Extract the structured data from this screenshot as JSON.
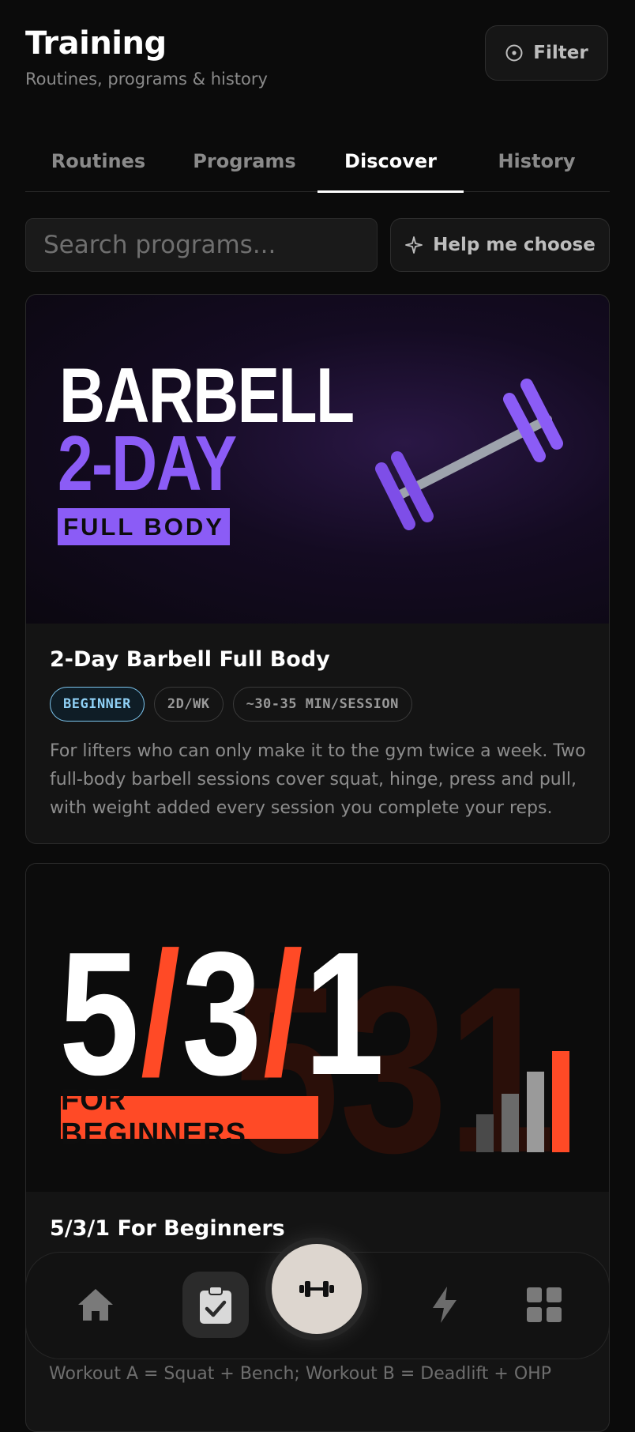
{
  "header": {
    "title": "Training",
    "subtitle": "Routines, programs & history",
    "filter_label": "Filter"
  },
  "tabs": [
    {
      "label": "Routines",
      "active": false
    },
    {
      "label": "Programs",
      "active": false
    },
    {
      "label": "Discover",
      "active": true
    },
    {
      "label": "History",
      "active": false
    }
  ],
  "search": {
    "placeholder": "Search programs...",
    "value": ""
  },
  "help_button": {
    "label": "Help me choose"
  },
  "programs": [
    {
      "hero": {
        "line1": "BARBELL",
        "line2": "2-DAY",
        "badge": "FULL BODY"
      },
      "title": "2-Day Barbell Full Body",
      "tags": [
        "BEGINNER",
        "2D/WK",
        "~30-35 MIN/SESSION"
      ],
      "description": "For lifters who can only make it to the gym twice a week. Two full-body barbell sessions cover squat, hinge, press and pull, with weight added every session you complete your reps. Low..."
    },
    {
      "hero": {
        "part1": "5",
        "sep": "/",
        "part2": "3",
        "part3": "1",
        "badge": "FOR BEGINNERS",
        "watermark": "531"
      },
      "title": "5/3/1 For Beginners",
      "description_visible": "Workout A = Squat + Bench; Workout B = Deadlift + OHP"
    }
  ],
  "nav": {
    "items": [
      "home-icon",
      "clipboard-check-icon",
      "dumbbell-icon",
      "lightning-icon",
      "grid-icon"
    ],
    "active": "dumbbell-icon"
  },
  "colors": {
    "background": "#0b0b0b",
    "purple_accent": "#8b5cf6",
    "orange_accent": "#ff4a26",
    "beginner_tag": "#8fd0f5"
  }
}
